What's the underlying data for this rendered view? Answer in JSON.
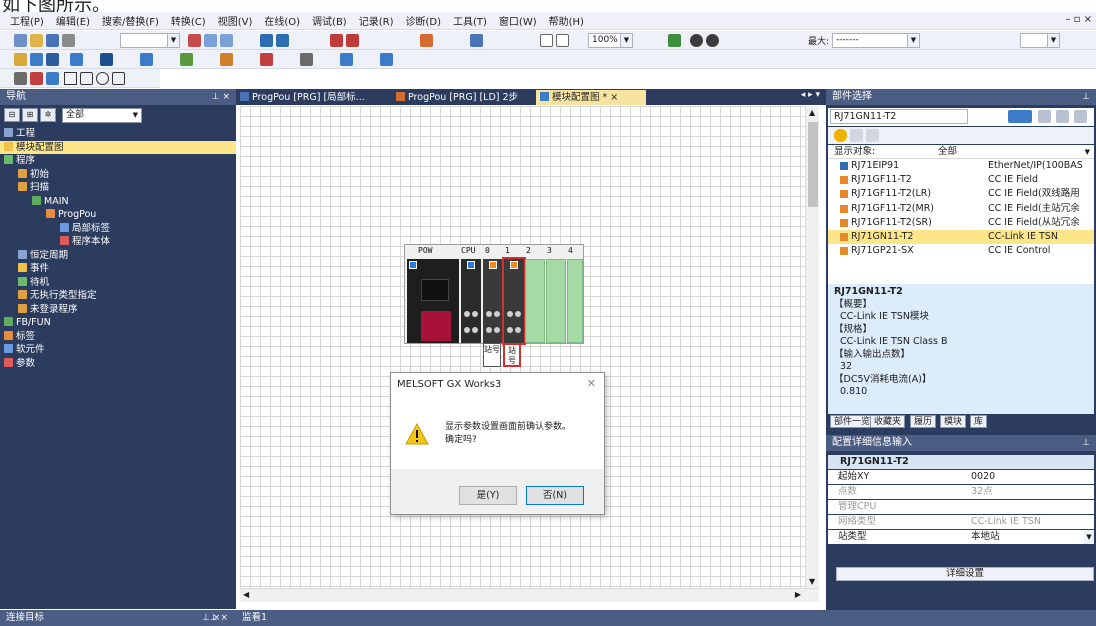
{
  "header_text": "如下图所示。",
  "menu": [
    "工程(P)",
    "编辑(E)",
    "搜索/替换(F)",
    "转换(C)",
    "视图(V)",
    "在线(O)",
    "调试(B)",
    "记录(R)",
    "诊断(D)",
    "工具(T)",
    "窗口(W)",
    "帮助(H)"
  ],
  "toolbar": {
    "zoom": "100%",
    "max_label": "最大:",
    "max_value": "-------"
  },
  "nav": {
    "title": "导航",
    "filter": "全部",
    "tree": [
      {
        "label": "工程",
        "indent": 0
      },
      {
        "label": "模块配置图",
        "indent": 0,
        "selected": true
      },
      {
        "label": "程序",
        "indent": 0
      },
      {
        "label": "初始",
        "indent": 1
      },
      {
        "label": "扫描",
        "indent": 1
      },
      {
        "label": "MAIN",
        "indent": 2
      },
      {
        "label": "ProgPou",
        "indent": 3
      },
      {
        "label": "局部标签",
        "indent": 4
      },
      {
        "label": "程序本体",
        "indent": 4
      },
      {
        "label": "恒定周期",
        "indent": 1
      },
      {
        "label": "事件",
        "indent": 1
      },
      {
        "label": "待机",
        "indent": 1
      },
      {
        "label": "无执行类型指定",
        "indent": 1
      },
      {
        "label": "未登录程序",
        "indent": 1
      },
      {
        "label": "FB/FUN",
        "indent": 0
      },
      {
        "label": "标签",
        "indent": 0
      },
      {
        "label": "软元件",
        "indent": 0
      },
      {
        "label": "参数",
        "indent": 0
      }
    ],
    "bottom": "连接目标"
  },
  "tabs": [
    "ProgPou [PRG] [局部标...",
    "ProgPou [PRG] [LD] 2步",
    "模块配置图 * ×"
  ],
  "rack": {
    "slot_labels": [
      "POW",
      "CPU",
      "0",
      "1",
      "2",
      "3",
      "4"
    ],
    "station_labels": [
      "站号",
      "站号"
    ]
  },
  "dialog": {
    "title": "MELSOFT GX Works3",
    "message_line1": "显示参数设置画面前确认参数。",
    "message_line2": "确定吗?",
    "yes": "是(Y)",
    "no": "否(N)"
  },
  "parts": {
    "title": "部件选择",
    "search_value": "RJ71GN11-T2",
    "filter_label": "显示对象:",
    "filter_value": "全部",
    "rows": [
      {
        "name": "RJ71EIP91",
        "desc": "EtherNet/IP(100BAS"
      },
      {
        "name": "RJ71GF11-T2",
        "desc": "CC IE Field"
      },
      {
        "name": "RJ71GF11-T2(LR)",
        "desc": "CC IE Field(双线路用"
      },
      {
        "name": "RJ71GF11-T2(MR)",
        "desc": "CC IE Field(主站冗余"
      },
      {
        "name": "RJ71GF11-T2(SR)",
        "desc": "CC IE Field(从站冗余"
      },
      {
        "name": "RJ71GN11-T2",
        "desc": "CC-Link IE TSN",
        "selected": true
      },
      {
        "name": "RJ71GP21-SX",
        "desc": "CC IE Control"
      }
    ],
    "desc_title": "RJ71GN11-T2",
    "desc": [
      "【概要】",
      "CC-Link IE TSN模块",
      "【规格】",
      "CC-Link IE TSN Class B",
      "【输入输出点数】",
      "32",
      "【DC5V消耗电流(A)】",
      "0.810"
    ],
    "tabs": [
      "部件一览",
      "收藏夹",
      "履历",
      "模块",
      "库"
    ]
  },
  "detail": {
    "title": "配置详细信息输入",
    "module": "RJ71GN11-T2",
    "rows": [
      {
        "k": "起始XY",
        "v": "0020",
        "dim": false
      },
      {
        "k": "点数",
        "v": "32点",
        "dim": true
      },
      {
        "k": "管理CPU",
        "v": "",
        "dim": true
      },
      {
        "k": "网络类型",
        "v": "CC-Link IE TSN",
        "dim": true
      },
      {
        "k": "站类型",
        "v": "本地站",
        "dim": false
      }
    ],
    "button": "详细设置"
  },
  "monitor": "监看1"
}
